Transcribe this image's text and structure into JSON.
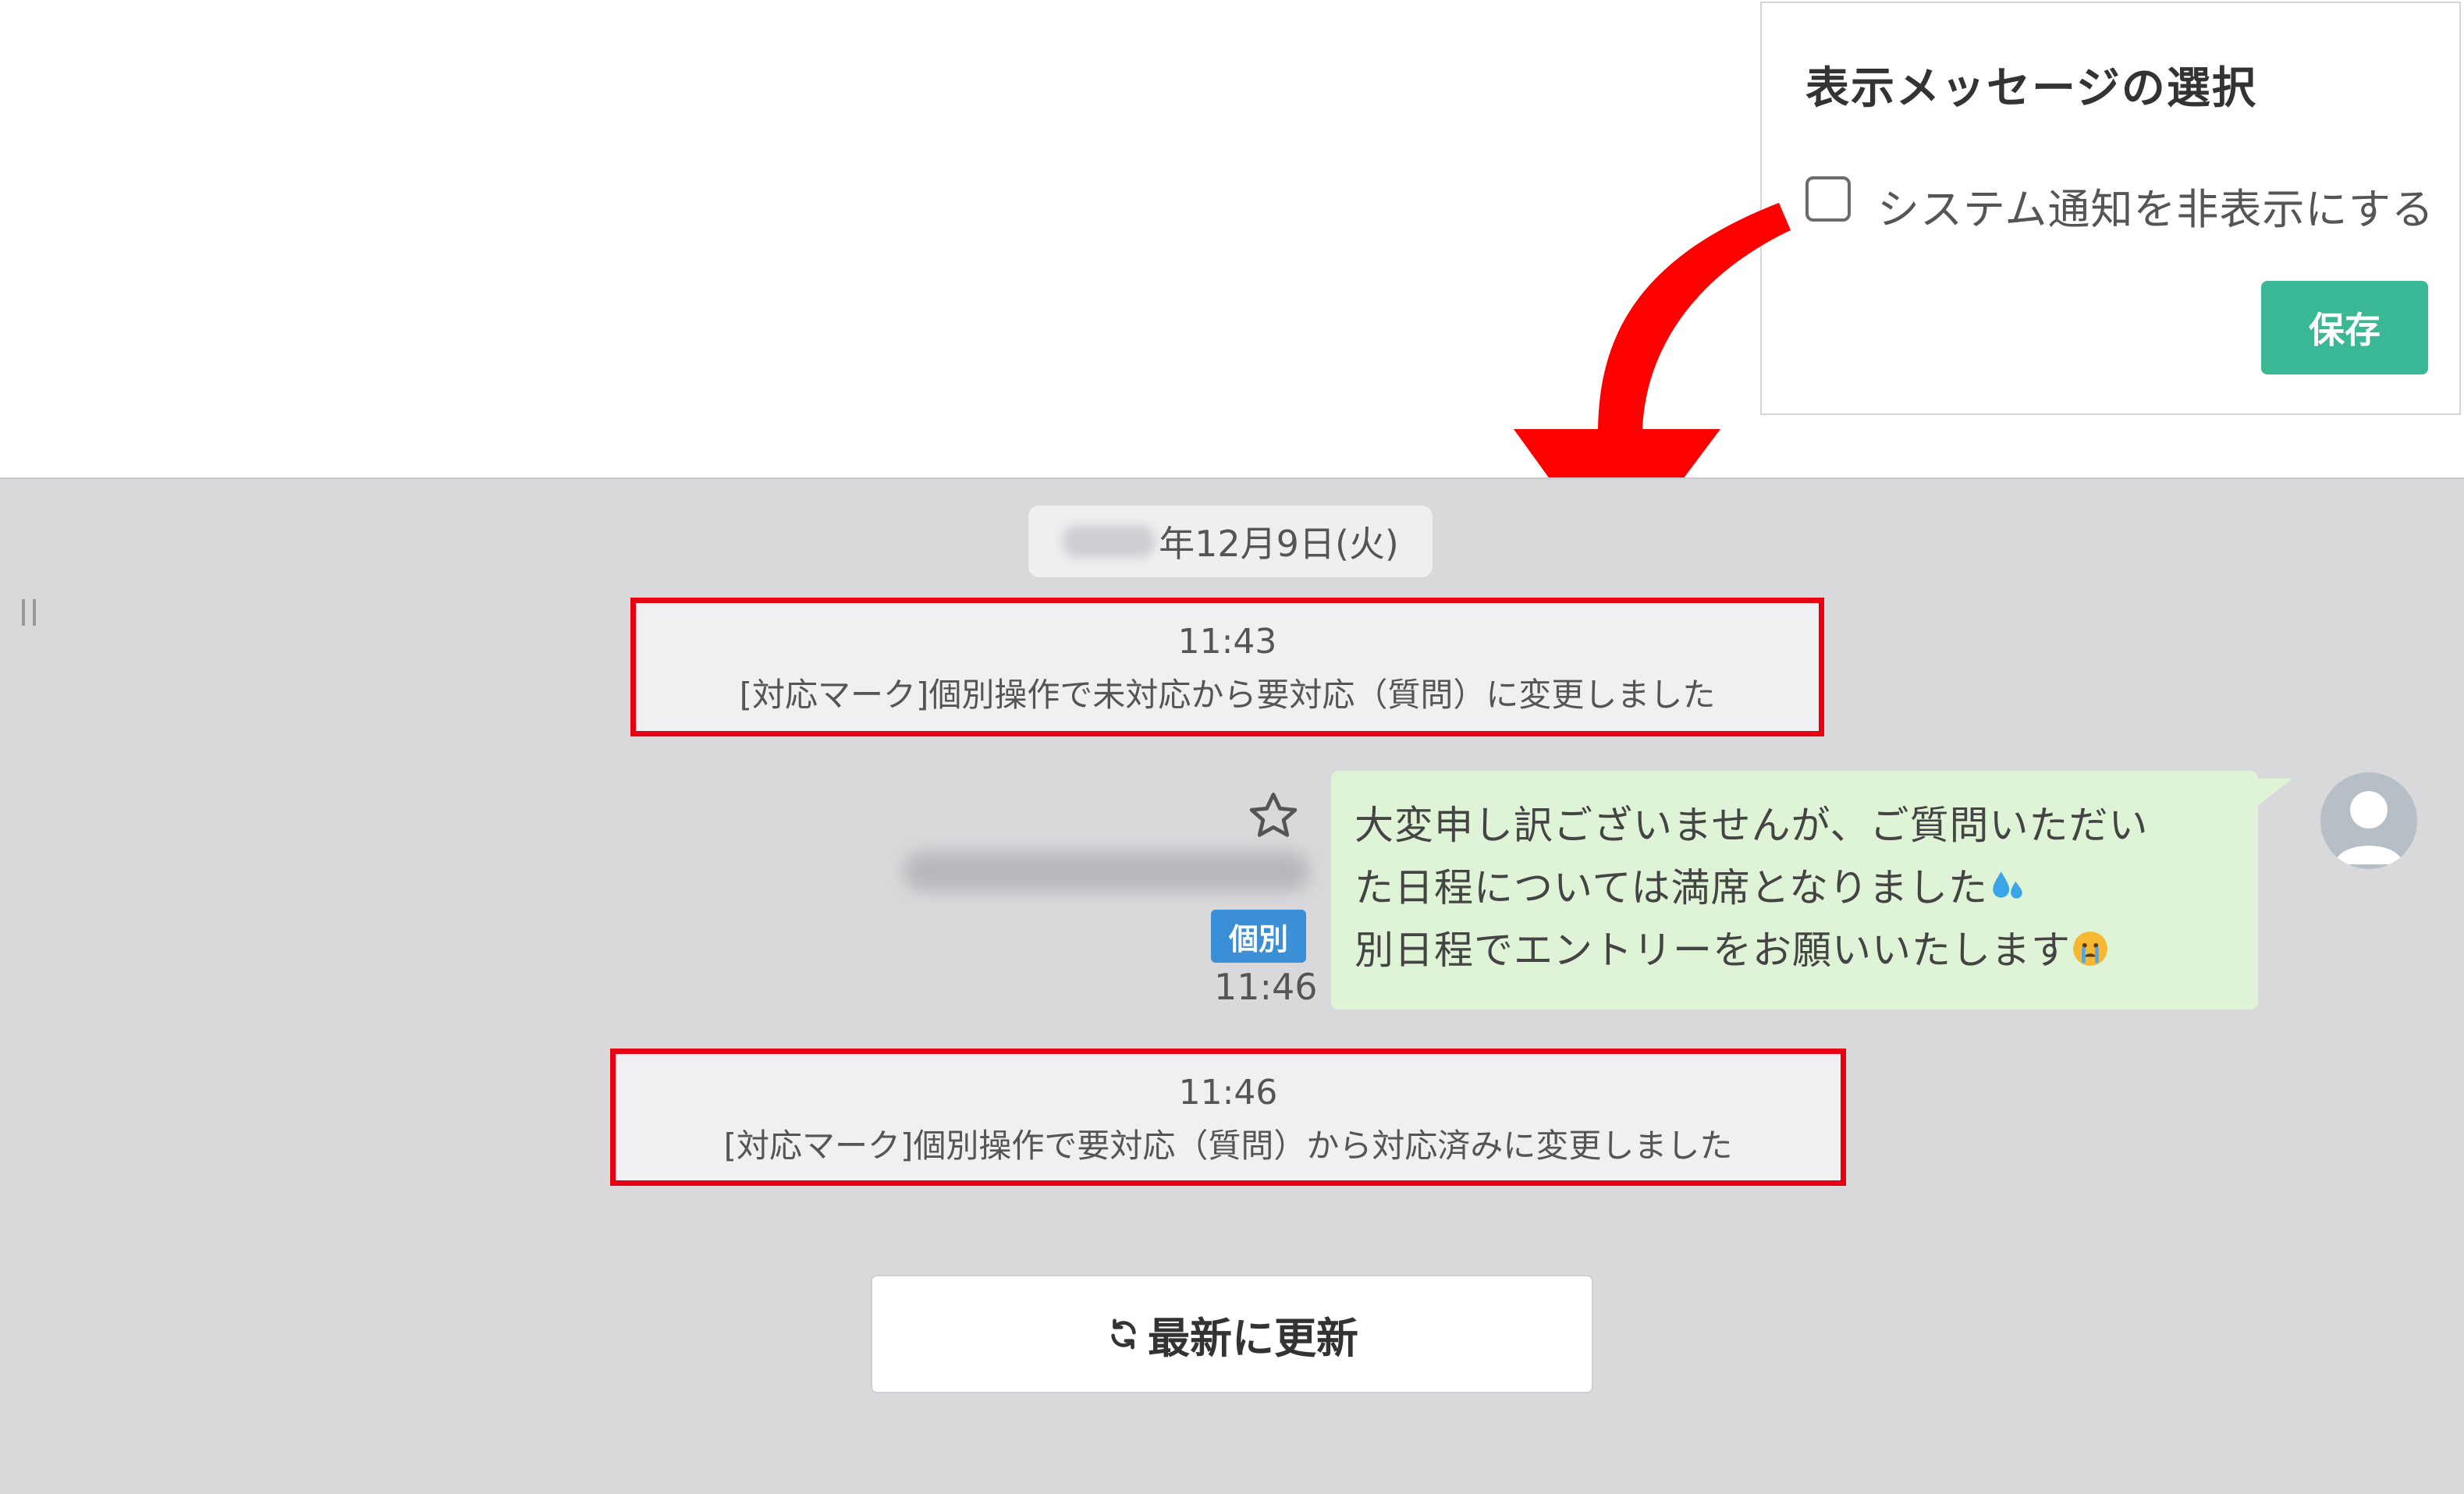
{
  "settings": {
    "title": "表示メッセージの選択",
    "hide_system_label": "システム通知を非表示にする",
    "hide_system_checked": false,
    "save_label": "保存",
    "save_color": "#3ab795"
  },
  "chat": {
    "date_label": "年12月9日(火)",
    "system_messages": [
      {
        "time": "11:43",
        "text": "[対応マーク]個別操作で未対応から要対応（質問）に変更しました"
      },
      {
        "time": "11:46",
        "text": "[対応マーク]個別操作で要対応（質問）から対応済みに変更しました"
      }
    ],
    "message": {
      "badge": "個別",
      "time": "11:46",
      "lines": [
        "大変申し訳ございませんが、ご質問いただい",
        "た日程については満席となりました",
        "別日程でエントリーをお願いいたします"
      ],
      "emojis": [
        "sweat-droplets-emoji",
        "crying-face-emoji"
      ]
    },
    "refresh_label": "最新に更新"
  },
  "colors": {
    "highlight_red": "#e60012",
    "chat_bg": "#d9d9db",
    "bubble_green": "#dff3d6",
    "badge_blue": "#3a8fd6"
  }
}
